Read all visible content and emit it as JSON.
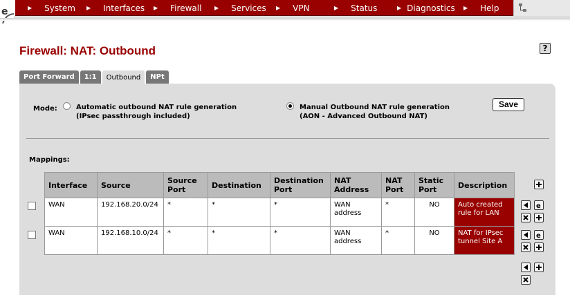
{
  "nav": {
    "items": [
      {
        "label": "System"
      },
      {
        "label": "Interfaces"
      },
      {
        "label": "Firewall"
      },
      {
        "label": "Services"
      },
      {
        "label": "VPN"
      },
      {
        "label": "Status"
      },
      {
        "label": "Diagnostics"
      },
      {
        "label": "Help"
      }
    ],
    "brand_color": "#990000"
  },
  "page": {
    "title": "Firewall: NAT: Outbound",
    "help": "?"
  },
  "tabs": [
    {
      "label": "Port Forward",
      "active": false
    },
    {
      "label": "1:1",
      "active": false
    },
    {
      "label": "Outbound",
      "active": true
    },
    {
      "label": "NPt",
      "active": false
    }
  ],
  "mode": {
    "label": "Mode:",
    "options": [
      {
        "line1": "Automatic outbound NAT rule generation",
        "line2": "(IPsec passthrough included)",
        "checked": false
      },
      {
        "line1": "Manual Outbound NAT rule generation",
        "line2": "(AON - Advanced Outbound NAT)",
        "checked": true
      }
    ],
    "save_label": "Save"
  },
  "mappings": {
    "label": "Mappings:",
    "columns": [
      "Interface",
      "Source",
      "Source Port",
      "Destination",
      "Destination Port",
      "NAT Address",
      "NAT Port",
      "Static Port",
      "Description"
    ],
    "rows": [
      {
        "interface": "WAN",
        "source": "192.168.20.0/24",
        "source_port": "*",
        "destination": "*",
        "destination_port": "*",
        "nat_address": "WAN address",
        "nat_port": "*",
        "static_port": "NO",
        "description": "Auto created rule for LAN"
      },
      {
        "interface": "WAN",
        "source": "192.168.10.0/24",
        "source_port": "*",
        "destination": "*",
        "destination_port": "*",
        "nat_address": "WAN address",
        "nat_port": "*",
        "static_port": "NO",
        "description": "NAT for IPsec tunnel Site A"
      }
    ]
  }
}
